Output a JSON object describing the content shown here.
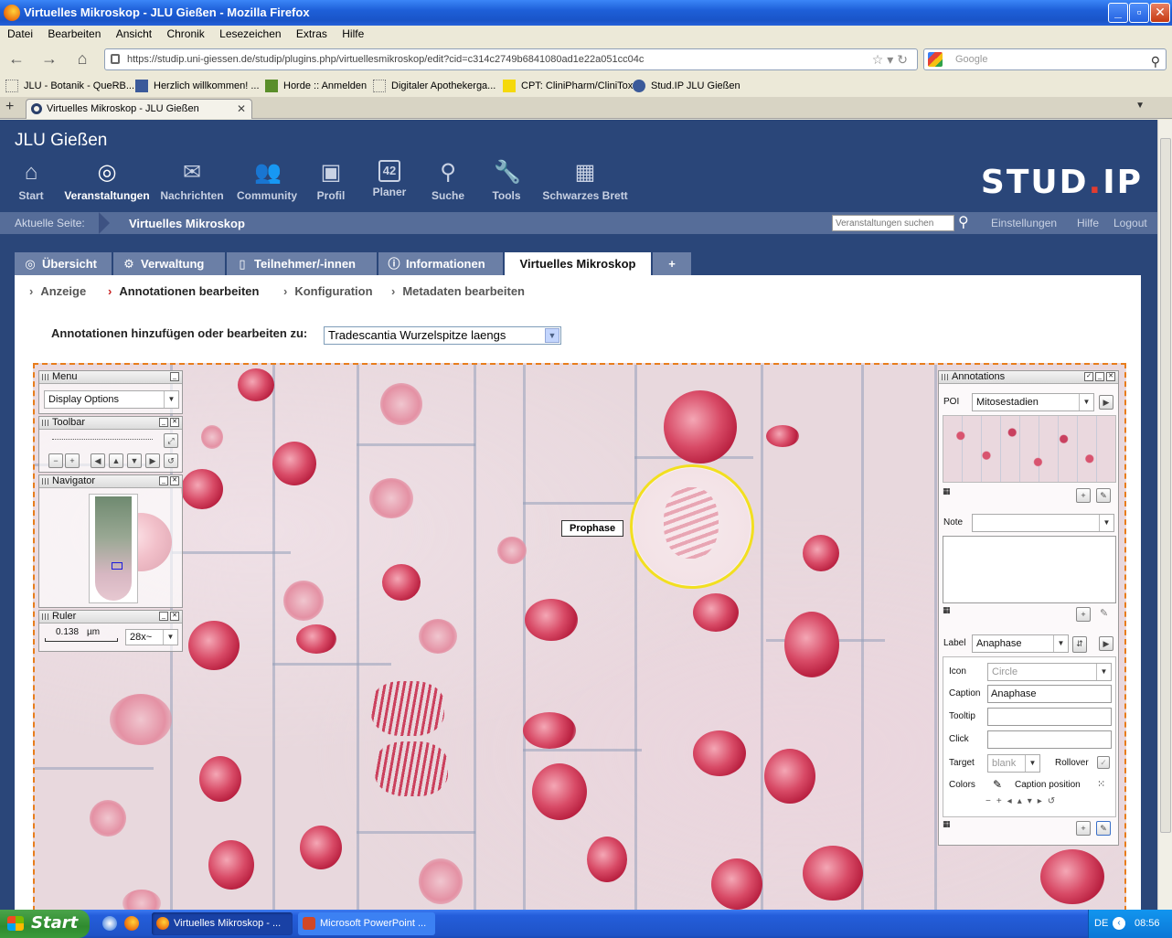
{
  "window": {
    "title": "Virtuelles Mikroskop - JLU Gießen - Mozilla Firefox",
    "controls": [
      "_",
      "▫",
      "✕"
    ]
  },
  "menu": [
    "Datei",
    "Bearbeiten",
    "Ansicht",
    "Chronik",
    "Lesezeichen",
    "Extras",
    "Hilfe"
  ],
  "address": {
    "url": "https://studip.uni-giessen.de/studip/plugins.php/virtuellesmikroskop/edit?cid=c314c2749b6841080ad1e22a051cc04c",
    "search_placeholder": "Google"
  },
  "bookmarks": [
    "JLU - Botanik - QueRB...",
    "Herzlich willkommen! ...",
    "Horde :: Anmelden",
    "Digitaler Apothekerga...",
    "CPT: CliniPharm/CliniTox",
    "Stud.IP JLU Gießen"
  ],
  "browser_tab": "Virtuelles Mikroskop - JLU Gießen",
  "site": {
    "title": "JLU Gießen",
    "logo_text_a": "STUD",
    "logo_dot": ".",
    "logo_text_b": "IP"
  },
  "topnav": [
    {
      "label": "Start",
      "icon": "home-icon"
    },
    {
      "label": "Veranstaltungen",
      "icon": "courses-icon"
    },
    {
      "label": "Nachrichten",
      "icon": "mail-icon"
    },
    {
      "label": "Community",
      "icon": "community-icon"
    },
    {
      "label": "Profil",
      "icon": "profile-icon"
    },
    {
      "label": "Planer",
      "icon": "calendar-icon",
      "badge": "42"
    },
    {
      "label": "Suche",
      "icon": "search-icon"
    },
    {
      "label": "Tools",
      "icon": "tools-icon"
    },
    {
      "label": "Schwarzes Brett",
      "icon": "board-icon"
    }
  ],
  "crumb": {
    "label": "Aktuelle Seite:",
    "page": "Virtuelles Mikroskop",
    "search_placeholder": "Veranstaltungen suchen",
    "links": [
      "Einstellungen",
      "Hilfe",
      "Logout"
    ]
  },
  "tabs": [
    {
      "label": "Übersicht"
    },
    {
      "label": "Verwaltung"
    },
    {
      "label": "Teilnehmer/-innen"
    },
    {
      "label": "Informationen"
    },
    {
      "label": "Virtuelles Mikroskop"
    },
    {
      "label": "+"
    }
  ],
  "subnav": [
    "Anzeige",
    "Annotationen bearbeiten",
    "Konfiguration",
    "Metadaten bearbeiten"
  ],
  "select": {
    "label": "Annotationen hinzufügen oder bearbeiten zu:",
    "value": "Tradescantia Wurzelspitze laengs"
  },
  "viewer": {
    "poi_label": "Prophase",
    "menu_panel": {
      "title": "Menu",
      "combo": "Display Options"
    },
    "toolbar_panel": {
      "title": "Toolbar"
    },
    "navigator_panel": {
      "title": "Navigator"
    },
    "ruler_panel": {
      "title": "Ruler",
      "value": "0.138",
      "unit": "µm",
      "zoom": "28x~"
    },
    "annotations": {
      "title": "Annotations",
      "poi_label": "POI",
      "poi_value": "Mitosestadien",
      "note_label": "Note",
      "label_label": "Label",
      "label_value": "Anaphase",
      "icon_label": "Icon",
      "icon_value": "Circle",
      "caption_label": "Caption",
      "caption_value": "Anaphase",
      "tooltip_label": "Tooltip",
      "click_label": "Click",
      "target_label": "Target",
      "target_value": "blank",
      "rollover_label": "Rollover",
      "colors_label": "Colors",
      "caption_position_label": "Caption position"
    }
  },
  "taskbar": {
    "start": "Start",
    "tasks": [
      "Virtuelles Mikroskop - ...",
      "Microsoft PowerPoint ..."
    ],
    "lang": "DE",
    "time": "08:56"
  }
}
